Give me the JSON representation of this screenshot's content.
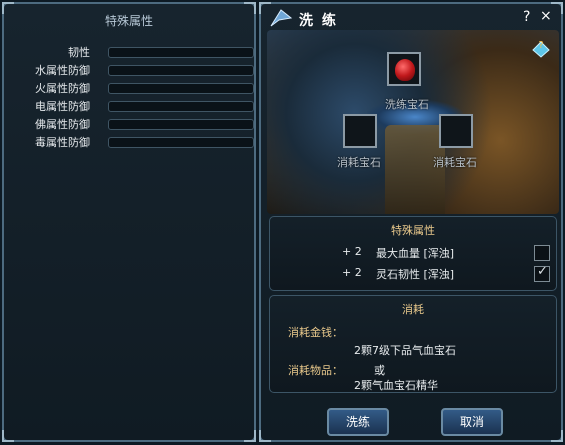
{
  "left_panel": {
    "title": "特殊属性",
    "stats": [
      {
        "label": "韧性"
      },
      {
        "label": "水属性防御"
      },
      {
        "label": "火属性防御"
      },
      {
        "label": "电属性防御"
      },
      {
        "label": "佛属性防御"
      },
      {
        "label": "毒属性防御"
      }
    ]
  },
  "dialog": {
    "title": "洗 练",
    "help_icon": "?",
    "close_icon": "×",
    "slots": {
      "main_label": "洗练宝石",
      "consume_left_label": "消耗宝石",
      "consume_right_label": "消耗宝石"
    },
    "special_attrs": {
      "title": "特殊属性",
      "rows": [
        {
          "plus": "+ 2",
          "name": "最大血量 [浑浊]",
          "checked": false
        },
        {
          "plus": "+ 2",
          "name": "灵石韧性 [浑浊]",
          "checked": true
        }
      ]
    },
    "consume": {
      "title": "消耗",
      "money_label": "消耗金钱：",
      "item_label": "消耗物品：",
      "item_line1": "2颗7级下品气血宝石",
      "item_or": "或",
      "item_line2": "2颗气血宝石精华"
    },
    "buttons": {
      "refine": "洗练",
      "cancel": "取消"
    }
  },
  "colors": {
    "accent_gold": "#e9c98c",
    "frame": "#4d6b80",
    "button": "#335b87"
  }
}
